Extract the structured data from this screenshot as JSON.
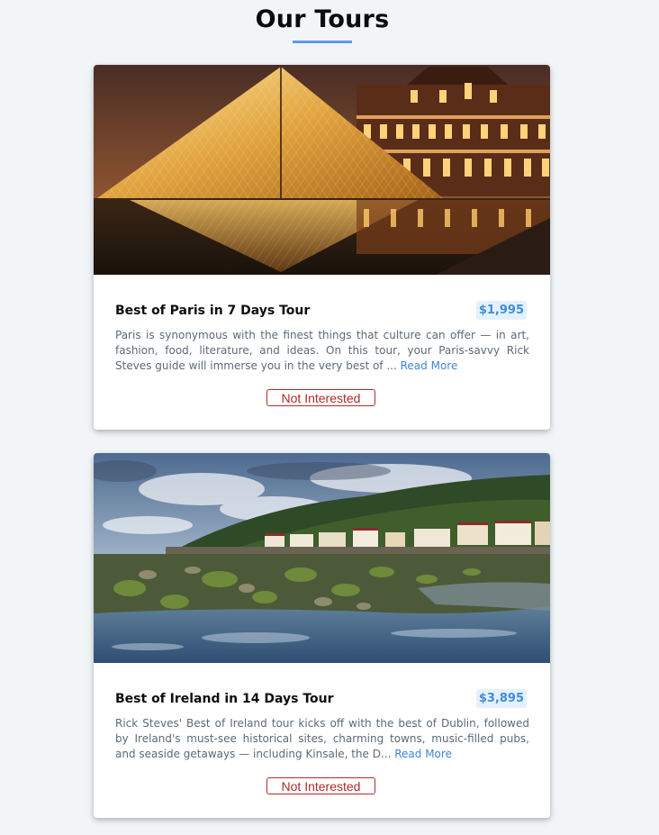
{
  "header": {
    "title": "Our Tours"
  },
  "tours": [
    {
      "name": "Best of Paris in 7 Days Tour",
      "price": "$1,995",
      "description": "Paris is synonymous with the finest things that culture can offer — in art, fashion, food, literature, and ideas. On this tour, your Paris-savvy Rick Steves guide will immerse you in the very best of ...",
      "read_more": "Read More",
      "button": "Not Interested"
    },
    {
      "name": "Best of Ireland in 14 Days Tour",
      "price": "$3,895",
      "description": "Rick Steves' Best of Ireland tour kicks off with the best of Dublin, followed by Ireland's must-see historical sites, charming towns, music-filled pubs, and seaside getaways — including Kinsale, the D...",
      "read_more": "Read More",
      "button": "Not Interested"
    }
  ],
  "colors": {
    "accent": "#5e9ae6",
    "price_text": "#3d8ee0",
    "price_bg": "#e4f1fc",
    "button_border": "#b22b2b",
    "background": "#f1f5f8"
  }
}
